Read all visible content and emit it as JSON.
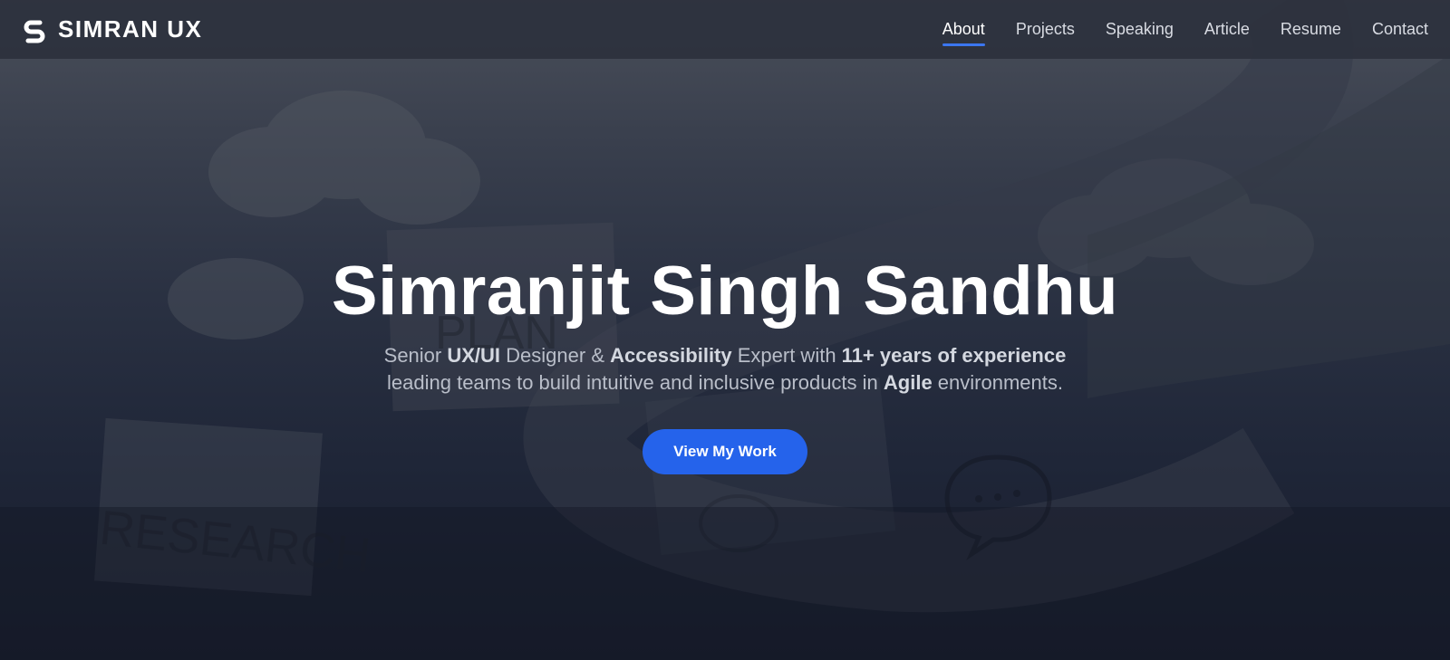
{
  "header": {
    "brand_name": "SIMRAN UX",
    "nav": [
      {
        "label": "About",
        "active": true
      },
      {
        "label": "Projects",
        "active": false
      },
      {
        "label": "Speaking",
        "active": false
      },
      {
        "label": "Article",
        "active": false
      },
      {
        "label": "Resume",
        "active": false
      },
      {
        "label": "Contact",
        "active": false
      }
    ]
  },
  "hero": {
    "title": "Simranjit Singh Sandhu",
    "subtitle_line1": {
      "t1": "Senior ",
      "b1": "UX/UI",
      "t2": " Designer & ",
      "b2": "Accessibility",
      "t3": " Expert with ",
      "b3": "11+ years of experience"
    },
    "subtitle_line2": {
      "t1": "leading teams to build intuitive and inclusive products in ",
      "b1": "Agile",
      "t2": " environments."
    },
    "cta_label": "View My Work",
    "background_words": [
      "PLAN",
      "RESEARCH"
    ]
  },
  "colors": {
    "accent": "#2563eb",
    "nav_underline": "#3b76f0",
    "navbar_bg": "#2c313d",
    "title": "#ffffff"
  },
  "icons": {
    "brand": "s-logo-icon",
    "bubble": "speech-bubble-icon"
  }
}
